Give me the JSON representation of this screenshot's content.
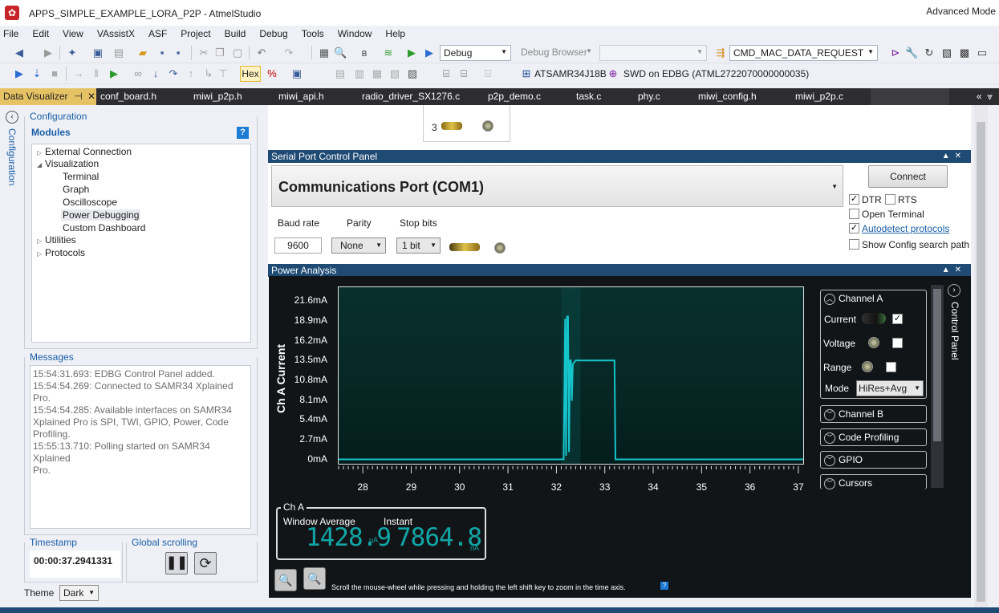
{
  "window": {
    "title": "APPS_SIMPLE_EXAMPLE_LORA_P2P - AtmelStudio",
    "advanced_mode": "Advanced Mode"
  },
  "menu": [
    "File",
    "Edit",
    "View",
    "VAssistX",
    "ASF",
    "Project",
    "Build",
    "Debug",
    "Tools",
    "Window",
    "Help"
  ],
  "toolbar1": {
    "config_combo": "Debug",
    "debug_browser": "Debug Browser",
    "search_combo": "CMD_MAC_DATA_REQUEST"
  },
  "toolbar2": {
    "hex_label": "Hex",
    "device": "ATSAMR34J18B",
    "tool": "SWD on EDBG (ATML2722070000000035)"
  },
  "tabs": [
    {
      "label": "Data Visualizer"
    },
    {
      "label": "conf_board.h"
    },
    {
      "label": "miwi_p2p.h"
    },
    {
      "label": "miwi_api.h"
    },
    {
      "label": "radio_driver_SX1276.c"
    },
    {
      "label": "p2p_demo.c"
    },
    {
      "label": "task.c"
    },
    {
      "label": "phy.c"
    },
    {
      "label": "miwi_config.h"
    },
    {
      "label": "miwi_p2p.c"
    }
  ],
  "sidebar": {
    "config_strip_label": "Configuration",
    "configuration_title": "Configuration",
    "modules_title": "Modules",
    "help": "?",
    "tree": {
      "external_connection": "External Connection",
      "visualization": "Visualization",
      "terminal": "Terminal",
      "graph": "Graph",
      "oscilloscope": "Oscilloscope",
      "power_debugging": "Power Debugging",
      "custom_dashboard": "Custom Dashboard",
      "utilities": "Utilities",
      "protocols": "Protocols"
    },
    "messages_title": "Messages",
    "messages": [
      "15:54:31.693: EDBG Control Panel added.",
      "15:54:54.269: Connected to SAMR34 Xplained Pro.",
      "15:54:54.285: Available interfaces on SAMR34",
      "Xplained Pro is SPI, TWI, GPIO, Power, Code",
      "Profiling.",
      "15:55:13.710: Polling started on SAMR34 Xplained",
      "Pro."
    ],
    "timestamp_title": "Timestamp",
    "timestamp_value": "00:00:37.2941331",
    "global_scrolling_title": "Global scrolling",
    "theme_label": "Theme",
    "theme_value": "Dark"
  },
  "top_item": {
    "index": "3"
  },
  "serial": {
    "title": "Serial Port Control Panel",
    "port": "Communications Port (COM1)",
    "connect": "Connect",
    "dtr": "DTR",
    "rts": "RTS",
    "open_terminal": "Open Terminal",
    "autodetect": "Autodetect protocols",
    "show_config": "Show Config search path",
    "baud_label": "Baud rate",
    "baud_value": "9600",
    "parity_label": "Parity",
    "parity_value": "None",
    "stop_label": "Stop bits",
    "stop_value": "1 bit"
  },
  "power": {
    "title": "Power Analysis",
    "ylabel": "Ch A Current",
    "yticks": [
      "21.6mA",
      "18.9mA",
      "16.2mA",
      "13.5mA",
      "10.8mA",
      "8.1mA",
      "5.4mA",
      "2.7mA",
      "0mA"
    ],
    "xticks": [
      "28",
      "29",
      "30",
      "31",
      "32",
      "33",
      "34",
      "35",
      "36",
      "37"
    ],
    "control_panel": {
      "label": "Control Panel",
      "channel_a": "Channel A",
      "current": "Current",
      "voltage": "Voltage",
      "range": "Range",
      "mode": "Mode",
      "mode_value": "HiRes+Avg",
      "channel_b": "Channel B",
      "code_profiling": "Code Profiling",
      "gpio": "GPIO",
      "cursors": "Cursors"
    },
    "cha": {
      "title": "Ch A",
      "window_average": "Window Average",
      "instant": "Instant",
      "avg_value": "1428.9",
      "avg_unit": "µA",
      "inst_value": "7864.8",
      "inst_unit": "nA"
    },
    "hint": "Scroll the mouse-wheel while pressing and holding the left shift key to zoom in the time axis.",
    "hint_help": "?"
  },
  "chart_data": {
    "type": "line",
    "ylabel": "Ch A Current",
    "xlim": [
      27.5,
      37.1
    ],
    "ylim": [
      -0.6,
      23.5
    ],
    "series": [
      {
        "points": [
          [
            27.5,
            0
          ],
          [
            32.15,
            0
          ],
          [
            32.18,
            19.2
          ],
          [
            32.2,
            0.5
          ],
          [
            32.22,
            19.5
          ],
          [
            32.24,
            19.5
          ],
          [
            32.26,
            1.0
          ],
          [
            32.28,
            13.5
          ],
          [
            32.3,
            13.5
          ],
          [
            32.32,
            8.0
          ],
          [
            32.34,
            13.0
          ],
          [
            32.4,
            13.5
          ],
          [
            33.2,
            13.5
          ],
          [
            33.22,
            0
          ],
          [
            37.1,
            0
          ]
        ]
      }
    ],
    "colors": {
      "line": "#16c4cc"
    }
  }
}
